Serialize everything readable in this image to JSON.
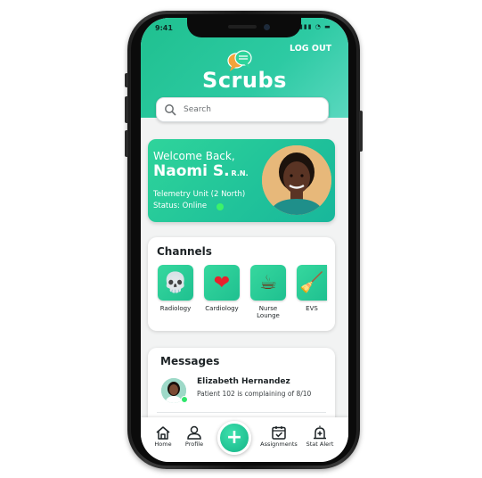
{
  "status_bar": {
    "time": "9:41",
    "icons": "▮▮▮ ◔ ▬"
  },
  "header": {
    "logout_label": "LOG OUT",
    "brand": "Scrubs"
  },
  "search": {
    "placeholder": "Search"
  },
  "welcome": {
    "greeting": "Welcome Back,",
    "name": "Naomi S.",
    "credential": "R.N.",
    "unit": "Telemetry Unit (2 North)",
    "status": "Status: Online",
    "status_color": "#3df26a"
  },
  "channels": {
    "title": "Channels",
    "items": [
      {
        "label": "Radiology",
        "icon": "skull-icon",
        "glyph": "💀"
      },
      {
        "label": "Cardiology",
        "icon": "heart-icon",
        "glyph": "❤"
      },
      {
        "label": "Nurse Lounge",
        "icon": "coffee-icon",
        "glyph": "☕"
      },
      {
        "label": "EVS",
        "icon": "broom-icon",
        "glyph": "🧹"
      }
    ]
  },
  "messages": {
    "title": "Messages",
    "items": [
      {
        "name": "Elizabeth Hernandez",
        "text": "Patient 102 is complaining of 8/10"
      }
    ]
  },
  "tabbar": {
    "items": [
      {
        "label": "Home",
        "icon": "home-icon"
      },
      {
        "label": "Profile",
        "icon": "profile-icon"
      },
      {
        "label": "Assignments",
        "icon": "calendar-check-icon"
      },
      {
        "label": "Stat Alert",
        "icon": "stat-alert-icon"
      }
    ],
    "fab": "+"
  },
  "colors": {
    "accent": "#1fc08f",
    "accent_light": "#5ad8bf"
  }
}
